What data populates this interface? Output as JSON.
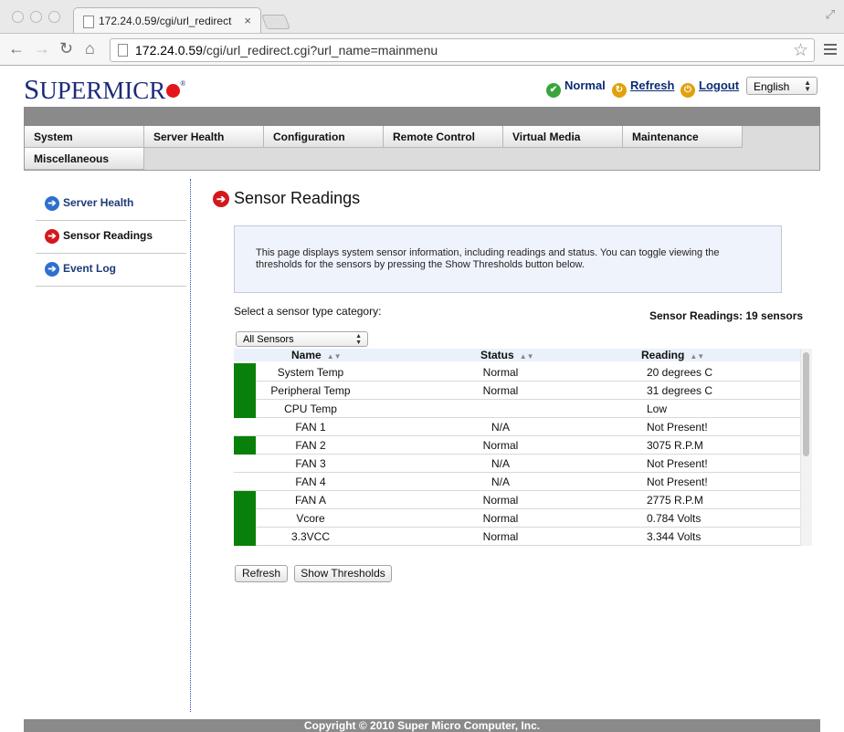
{
  "browser": {
    "tab_title": "172.24.0.59/cgi/url_redirect",
    "tab_close": "×",
    "url_host": "172.24.0.59",
    "url_path": "/cgi/url_redirect.cgi?url_name=mainmenu",
    "icons": [
      "back-icon",
      "forward-icon",
      "reload-icon",
      "home-icon",
      "bookmark-star-icon",
      "chrome-menu-icon"
    ]
  },
  "header": {
    "logo_first": "S",
    "logo_rest": "UPERMICR",
    "logo_reg": "®",
    "status_label": "Normal",
    "refresh_label": "Refresh",
    "logout_label": "Logout",
    "language": "English",
    "colors": {
      "brand_blue": "#1d2a7a",
      "brand_red": "#e3161b",
      "status_green": "#3aa53a"
    }
  },
  "menu": {
    "row1": [
      "System",
      "Server Health",
      "Configuration",
      "Remote Control",
      "Virtual Media",
      "Maintenance"
    ],
    "row2": [
      "Miscellaneous"
    ]
  },
  "sidebar": {
    "items": [
      {
        "label": "Server Health",
        "active": false
      },
      {
        "label": "Sensor Readings",
        "active": true
      },
      {
        "label": "Event Log",
        "active": false
      }
    ]
  },
  "main": {
    "title": "Sensor Readings",
    "info": "This page displays system sensor information, including readings and status. You can toggle viewing the thresholds for the sensors by pressing the Show Thresholds button below.",
    "select_label": "Select a sensor type category:",
    "sensor_count": "Sensor Readings: 19 sensors",
    "category": "All Sensors",
    "columns": {
      "name": "Name",
      "status": "Status",
      "reading": "Reading"
    },
    "rows": [
      {
        "name": "System Temp",
        "status": "Normal",
        "reading": "20 degrees C",
        "ok": true
      },
      {
        "name": "Peripheral Temp",
        "status": "Normal",
        "reading": "31 degrees C",
        "ok": true
      },
      {
        "name": "CPU Temp",
        "status": "",
        "reading": "Low",
        "ok": true
      },
      {
        "name": "FAN 1",
        "status": "N/A",
        "reading": "Not Present!",
        "ok": false
      },
      {
        "name": "FAN 2",
        "status": "Normal",
        "reading": "3075 R.P.M",
        "ok": true
      },
      {
        "name": "FAN 3",
        "status": "N/A",
        "reading": "Not Present!",
        "ok": false
      },
      {
        "name": "FAN 4",
        "status": "N/A",
        "reading": "Not Present!",
        "ok": false
      },
      {
        "name": "FAN A",
        "status": "Normal",
        "reading": "2775 R.P.M",
        "ok": true
      },
      {
        "name": "Vcore",
        "status": "Normal",
        "reading": "0.784 Volts",
        "ok": true
      },
      {
        "name": "3.3VCC",
        "status": "Normal",
        "reading": "3.344 Volts",
        "ok": true
      }
    ],
    "refresh_button": "Refresh",
    "thresholds_button": "Show Thresholds",
    "ok_color": "#098009"
  },
  "footer": {
    "copyright": "Copyright © 2010 Super Micro Computer, Inc."
  }
}
